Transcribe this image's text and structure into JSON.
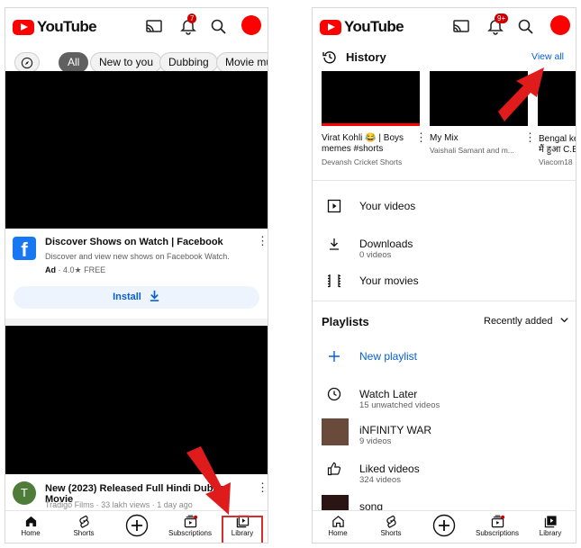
{
  "left": {
    "brand": "YouTube",
    "notif_count": "7",
    "chips": [
      "All",
      "New to you",
      "Dubbing",
      "Movie mus"
    ],
    "ad": {
      "title": "Discover Shows on Watch | Facebook",
      "description": "Discover and view new shows on Facebook Watch.",
      "ad_label": "Ad",
      "rating": "· 4.0★ FREE",
      "install": "Install",
      "icon_letter": "f"
    },
    "video2": {
      "title": "New (2023) Released Full Hindi Dubbed Movie",
      "meta": "Tradigo Films · 33 lakh views · 1 day ago",
      "avatar_letter": "T"
    },
    "nav": [
      "Home",
      "Shorts",
      "Subscriptions",
      "Library"
    ]
  },
  "right": {
    "brand": "YouTube",
    "notif_count": "9+",
    "history": {
      "title": "History",
      "view_all": "View all",
      "items": [
        {
          "title": "Virat Kohli 😂 | Boys memes #shorts",
          "sub": "Devansh Cricket Shorts"
        },
        {
          "title": "My Mix",
          "sub": "Vaishali Samant and m..."
        },
        {
          "title": "Bengal ke मैं हुआ C.B",
          "sub": "Viacom18"
        }
      ]
    },
    "library": [
      {
        "label": "Your videos",
        "sub": ""
      },
      {
        "label": "Downloads",
        "sub": "0 videos"
      },
      {
        "label": "Your movies",
        "sub": ""
      }
    ],
    "playlists": {
      "title": "Playlists",
      "sort": "Recently added",
      "new": "New playlist",
      "items": [
        {
          "label": "Watch Later",
          "sub": "15 unwatched videos"
        },
        {
          "label": "iNFINITY WAR",
          "sub": "9 videos"
        },
        {
          "label": "Liked videos",
          "sub": "324 videos"
        },
        {
          "label": "song",
          "sub": ""
        }
      ]
    },
    "nav": [
      "Home",
      "Shorts",
      "Subscriptions",
      "Library"
    ]
  },
  "colors": {
    "brand_red": "#ff0000",
    "link_blue": "#065fd4",
    "arrow_red": "#e01b1b"
  }
}
